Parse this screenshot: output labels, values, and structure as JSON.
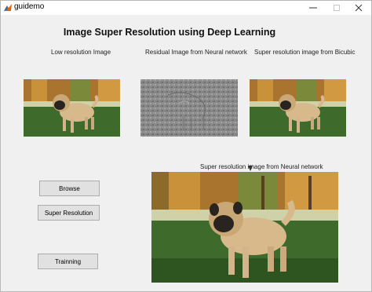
{
  "window": {
    "title": "guidemo",
    "icon": "matlab-figure-icon"
  },
  "heading": "Image Super Resolution using Deep Learning",
  "panels": {
    "low_res_label": "Low resolution Image",
    "residual_label": "Residual Image from  Neural network",
    "bicubic_label": "Super resolution image from Bicubic",
    "neural_label": "Super resolution image from Neural network"
  },
  "buttons": {
    "browse": "Browse",
    "super_resolution": "Super Resolution",
    "training": "Trainning"
  },
  "colors": {
    "figure_bg": "#f0f0f0",
    "button_bg": "#e1e1e1",
    "grass": "#3e6a2c",
    "trees_autumn": "#b07a30",
    "pug_fawn": "#d8b98c",
    "residual_gray": "#8a8a8a"
  }
}
